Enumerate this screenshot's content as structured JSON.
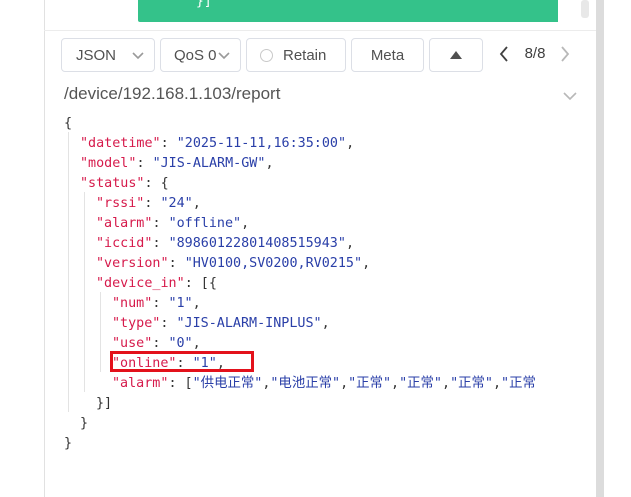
{
  "message_tail": "}]",
  "toolbar": {
    "format_label": "JSON",
    "qos_label": "QoS 0",
    "retain_label": "Retain",
    "meta_label": "Meta",
    "page_indicator": "8/8"
  },
  "topic": "/device/192.168.1.103/report",
  "json_lines": [
    {
      "indent": 0,
      "parts": [
        {
          "t": "p",
          "v": "{"
        }
      ]
    },
    {
      "indent": 1,
      "parts": [
        {
          "t": "k",
          "v": "\"datetime\""
        },
        {
          "t": "p",
          "v": ": "
        },
        {
          "t": "s",
          "v": "\"2025-11-11,16:35:00\""
        },
        {
          "t": "p",
          "v": ","
        }
      ]
    },
    {
      "indent": 1,
      "parts": [
        {
          "t": "k",
          "v": "\"model\""
        },
        {
          "t": "p",
          "v": ": "
        },
        {
          "t": "s",
          "v": "\"JIS-ALARM-GW\""
        },
        {
          "t": "p",
          "v": ","
        }
      ]
    },
    {
      "indent": 1,
      "parts": [
        {
          "t": "k",
          "v": "\"status\""
        },
        {
          "t": "p",
          "v": ": {"
        }
      ]
    },
    {
      "indent": 2,
      "parts": [
        {
          "t": "k",
          "v": "\"rssi\""
        },
        {
          "t": "p",
          "v": ": "
        },
        {
          "t": "s",
          "v": "\"24\""
        },
        {
          "t": "p",
          "v": ","
        }
      ]
    },
    {
      "indent": 2,
      "parts": [
        {
          "t": "k",
          "v": "\"alarm\""
        },
        {
          "t": "p",
          "v": ": "
        },
        {
          "t": "s",
          "v": "\"offline\""
        },
        {
          "t": "p",
          "v": ","
        }
      ]
    },
    {
      "indent": 2,
      "parts": [
        {
          "t": "k",
          "v": "\"iccid\""
        },
        {
          "t": "p",
          "v": ": "
        },
        {
          "t": "s",
          "v": "\"89860122801408515943\""
        },
        {
          "t": "p",
          "v": ","
        }
      ]
    },
    {
      "indent": 2,
      "parts": [
        {
          "t": "k",
          "v": "\"version\""
        },
        {
          "t": "p",
          "v": ": "
        },
        {
          "t": "s",
          "v": "\"HV0100,SV0200,RV0215\""
        },
        {
          "t": "p",
          "v": ","
        }
      ]
    },
    {
      "indent": 2,
      "parts": [
        {
          "t": "k",
          "v": "\"device_in\""
        },
        {
          "t": "p",
          "v": ": [{"
        }
      ]
    },
    {
      "indent": 3,
      "parts": [
        {
          "t": "k",
          "v": "\"num\""
        },
        {
          "t": "p",
          "v": ": "
        },
        {
          "t": "s",
          "v": "\"1\""
        },
        {
          "t": "p",
          "v": ","
        }
      ]
    },
    {
      "indent": 3,
      "parts": [
        {
          "t": "k",
          "v": "\"type\""
        },
        {
          "t": "p",
          "v": ": "
        },
        {
          "t": "s",
          "v": "\"JIS-ALARM-INPLUS\""
        },
        {
          "t": "p",
          "v": ","
        }
      ]
    },
    {
      "indent": 3,
      "parts": [
        {
          "t": "k",
          "v": "\"use\""
        },
        {
          "t": "p",
          "v": ": "
        },
        {
          "t": "s",
          "v": "\"0\""
        },
        {
          "t": "p",
          "v": ","
        }
      ]
    },
    {
      "indent": 3,
      "parts": [
        {
          "t": "k",
          "v": "\"online\""
        },
        {
          "t": "p",
          "v": ": "
        },
        {
          "t": "s",
          "v": "\"1\""
        },
        {
          "t": "p",
          "v": ","
        }
      ]
    },
    {
      "indent": 3,
      "parts": [
        {
          "t": "k",
          "v": "\"alarm\""
        },
        {
          "t": "p",
          "v": ": ["
        },
        {
          "t": "s",
          "v": "\"供电正常\""
        },
        {
          "t": "p",
          "v": ","
        },
        {
          "t": "s",
          "v": "\"电池正常\""
        },
        {
          "t": "p",
          "v": ","
        },
        {
          "t": "s",
          "v": "\"正常\""
        },
        {
          "t": "p",
          "v": ","
        },
        {
          "t": "s",
          "v": "\"正常\""
        },
        {
          "t": "p",
          "v": ","
        },
        {
          "t": "s",
          "v": "\"正常\""
        },
        {
          "t": "p",
          "v": ","
        },
        {
          "t": "s",
          "v": "\"正常"
        }
      ]
    },
    {
      "indent": 2,
      "parts": [
        {
          "t": "p",
          "v": "}]"
        }
      ]
    },
    {
      "indent": 1,
      "parts": [
        {
          "t": "p",
          "v": "}"
        }
      ]
    },
    {
      "indent": 0,
      "parts": [
        {
          "t": "p",
          "v": "}"
        }
      ]
    }
  ]
}
